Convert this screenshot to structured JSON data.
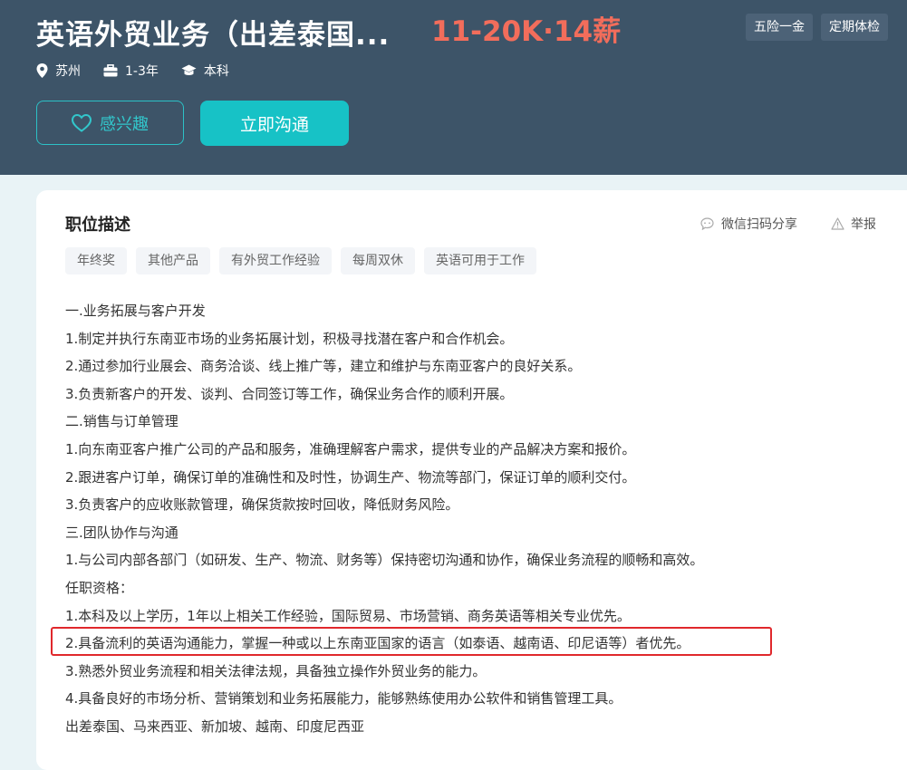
{
  "header": {
    "title": "英语外贸业务（出差泰国...",
    "salary": "11-20K·14薪",
    "benefits": [
      "五险一金",
      "定期体检"
    ],
    "meta": {
      "location": "苏州",
      "experience": "1-3年",
      "education": "本科"
    },
    "interest_button": "感兴趣",
    "chat_button": "立即沟通"
  },
  "colors": {
    "header_bg": "#3d5468",
    "accent": "#17c2c6",
    "salary": "#f26d5b",
    "highlight": "#e0282c"
  },
  "description": {
    "title": "职位描述",
    "share_label": "微信扫码分享",
    "report_label": "举报",
    "tags": [
      "年终奖",
      "其他产品",
      "有外贸工作经验",
      "每周双休",
      "英语可用于工作"
    ],
    "lines": [
      "一.业务拓展与客户开发",
      "1.制定并执行东南亚市场的业务拓展计划，积极寻找潜在客户和合作机会。",
      "2.通过参加行业展会、商务洽谈、线上推广等，建立和维护与东南亚客户的良好关系。",
      "3.负责新客户的开发、谈判、合同签订等工作，确保业务合作的顺利开展。",
      "二.销售与订单管理",
      "1.向东南亚客户推广公司的产品和服务，准确理解客户需求，提供专业的产品解决方案和报价。",
      "2.跟进客户订单，确保订单的准确性和及时性，协调生产、物流等部门，保证订单的顺利交付。",
      "3.负责客户的应收账款管理，确保货款按时回收，降低财务风险。",
      "三.团队协作与沟通",
      "1.与公司内部各部门（如研发、生产、物流、财务等）保持密切沟通和协作，确保业务流程的顺畅和高效。",
      "任职资格：",
      "1.本科及以上学历，1年以上相关工作经验，国际贸易、市场营销、商务英语等相关专业优先。",
      "2.具备流利的英语沟通能力，掌握一种或以上东南亚国家的语言（如泰语、越南语、印尼语等）者优先。",
      "3.熟悉外贸业务流程和相关法律法规，具备独立操作外贸业务的能力。",
      "4.具备良好的市场分析、营销策划和业务拓展能力，能够熟练使用办公软件和销售管理工具。",
      "出差泰国、马来西亚、新加坡、越南、印度尼西亚"
    ]
  }
}
